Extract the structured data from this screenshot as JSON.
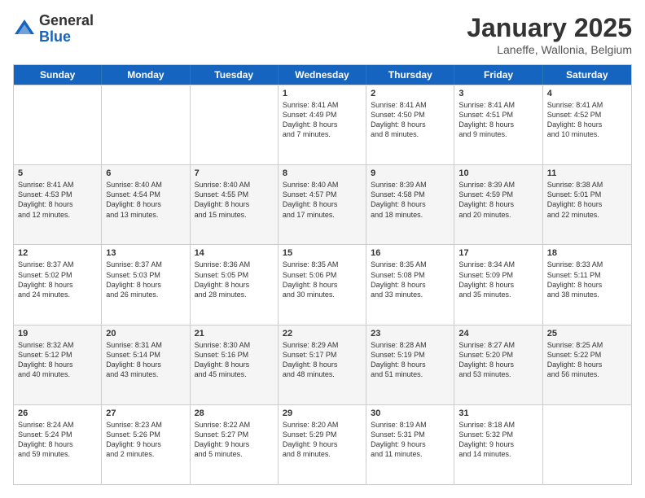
{
  "logo": {
    "general": "General",
    "blue": "Blue"
  },
  "header": {
    "month": "January 2025",
    "location": "Laneffe, Wallonia, Belgium"
  },
  "weekdays": [
    "Sunday",
    "Monday",
    "Tuesday",
    "Wednesday",
    "Thursday",
    "Friday",
    "Saturday"
  ],
  "rows": [
    {
      "alt": false,
      "cells": [
        {
          "day": "",
          "info": ""
        },
        {
          "day": "",
          "info": ""
        },
        {
          "day": "",
          "info": ""
        },
        {
          "day": "1",
          "info": "Sunrise: 8:41 AM\nSunset: 4:49 PM\nDaylight: 8 hours\nand 7 minutes."
        },
        {
          "day": "2",
          "info": "Sunrise: 8:41 AM\nSunset: 4:50 PM\nDaylight: 8 hours\nand 8 minutes."
        },
        {
          "day": "3",
          "info": "Sunrise: 8:41 AM\nSunset: 4:51 PM\nDaylight: 8 hours\nand 9 minutes."
        },
        {
          "day": "4",
          "info": "Sunrise: 8:41 AM\nSunset: 4:52 PM\nDaylight: 8 hours\nand 10 minutes."
        }
      ]
    },
    {
      "alt": true,
      "cells": [
        {
          "day": "5",
          "info": "Sunrise: 8:41 AM\nSunset: 4:53 PM\nDaylight: 8 hours\nand 12 minutes."
        },
        {
          "day": "6",
          "info": "Sunrise: 8:40 AM\nSunset: 4:54 PM\nDaylight: 8 hours\nand 13 minutes."
        },
        {
          "day": "7",
          "info": "Sunrise: 8:40 AM\nSunset: 4:55 PM\nDaylight: 8 hours\nand 15 minutes."
        },
        {
          "day": "8",
          "info": "Sunrise: 8:40 AM\nSunset: 4:57 PM\nDaylight: 8 hours\nand 17 minutes."
        },
        {
          "day": "9",
          "info": "Sunrise: 8:39 AM\nSunset: 4:58 PM\nDaylight: 8 hours\nand 18 minutes."
        },
        {
          "day": "10",
          "info": "Sunrise: 8:39 AM\nSunset: 4:59 PM\nDaylight: 8 hours\nand 20 minutes."
        },
        {
          "day": "11",
          "info": "Sunrise: 8:38 AM\nSunset: 5:01 PM\nDaylight: 8 hours\nand 22 minutes."
        }
      ]
    },
    {
      "alt": false,
      "cells": [
        {
          "day": "12",
          "info": "Sunrise: 8:37 AM\nSunset: 5:02 PM\nDaylight: 8 hours\nand 24 minutes."
        },
        {
          "day": "13",
          "info": "Sunrise: 8:37 AM\nSunset: 5:03 PM\nDaylight: 8 hours\nand 26 minutes."
        },
        {
          "day": "14",
          "info": "Sunrise: 8:36 AM\nSunset: 5:05 PM\nDaylight: 8 hours\nand 28 minutes."
        },
        {
          "day": "15",
          "info": "Sunrise: 8:35 AM\nSunset: 5:06 PM\nDaylight: 8 hours\nand 30 minutes."
        },
        {
          "day": "16",
          "info": "Sunrise: 8:35 AM\nSunset: 5:08 PM\nDaylight: 8 hours\nand 33 minutes."
        },
        {
          "day": "17",
          "info": "Sunrise: 8:34 AM\nSunset: 5:09 PM\nDaylight: 8 hours\nand 35 minutes."
        },
        {
          "day": "18",
          "info": "Sunrise: 8:33 AM\nSunset: 5:11 PM\nDaylight: 8 hours\nand 38 minutes."
        }
      ]
    },
    {
      "alt": true,
      "cells": [
        {
          "day": "19",
          "info": "Sunrise: 8:32 AM\nSunset: 5:12 PM\nDaylight: 8 hours\nand 40 minutes."
        },
        {
          "day": "20",
          "info": "Sunrise: 8:31 AM\nSunset: 5:14 PM\nDaylight: 8 hours\nand 43 minutes."
        },
        {
          "day": "21",
          "info": "Sunrise: 8:30 AM\nSunset: 5:16 PM\nDaylight: 8 hours\nand 45 minutes."
        },
        {
          "day": "22",
          "info": "Sunrise: 8:29 AM\nSunset: 5:17 PM\nDaylight: 8 hours\nand 48 minutes."
        },
        {
          "day": "23",
          "info": "Sunrise: 8:28 AM\nSunset: 5:19 PM\nDaylight: 8 hours\nand 51 minutes."
        },
        {
          "day": "24",
          "info": "Sunrise: 8:27 AM\nSunset: 5:20 PM\nDaylight: 8 hours\nand 53 minutes."
        },
        {
          "day": "25",
          "info": "Sunrise: 8:25 AM\nSunset: 5:22 PM\nDaylight: 8 hours\nand 56 minutes."
        }
      ]
    },
    {
      "alt": false,
      "cells": [
        {
          "day": "26",
          "info": "Sunrise: 8:24 AM\nSunset: 5:24 PM\nDaylight: 8 hours\nand 59 minutes."
        },
        {
          "day": "27",
          "info": "Sunrise: 8:23 AM\nSunset: 5:26 PM\nDaylight: 9 hours\nand 2 minutes."
        },
        {
          "day": "28",
          "info": "Sunrise: 8:22 AM\nSunset: 5:27 PM\nDaylight: 9 hours\nand 5 minutes."
        },
        {
          "day": "29",
          "info": "Sunrise: 8:20 AM\nSunset: 5:29 PM\nDaylight: 9 hours\nand 8 minutes."
        },
        {
          "day": "30",
          "info": "Sunrise: 8:19 AM\nSunset: 5:31 PM\nDaylight: 9 hours\nand 11 minutes."
        },
        {
          "day": "31",
          "info": "Sunrise: 8:18 AM\nSunset: 5:32 PM\nDaylight: 9 hours\nand 14 minutes."
        },
        {
          "day": "",
          "info": ""
        }
      ]
    }
  ]
}
